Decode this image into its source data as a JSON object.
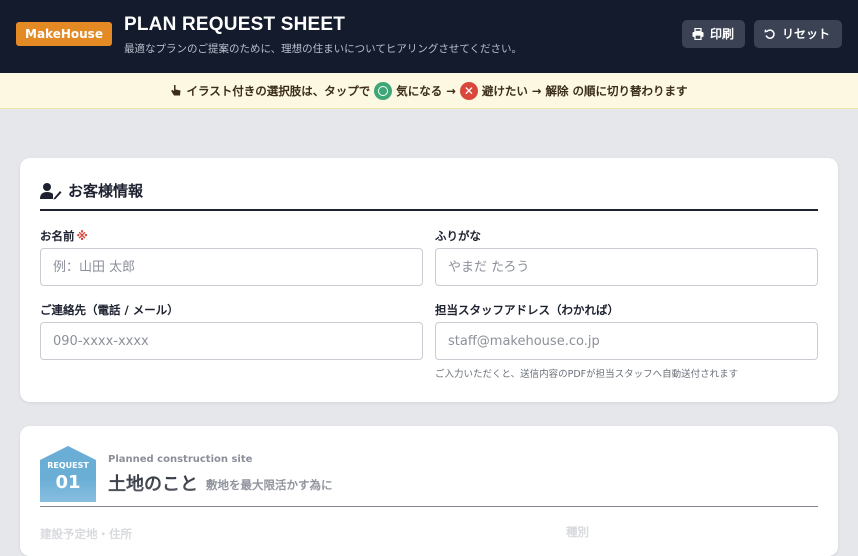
{
  "header": {
    "logo": "MakeHouse",
    "title": "PLAN REQUEST SHEET",
    "subtitle": "最適なプランのご提案のために、理想の住まいについてヒアリングさせてください。",
    "print_label": "印刷",
    "reset_label": "リセット"
  },
  "notice": {
    "text1": "イラスト付きの選択肢は、タップで",
    "ok_label": "気になる",
    "arrow1": "→",
    "ng_label": "避けたい",
    "text2": "→ 解除 の順に切り替わります",
    "ng_mark": "✕"
  },
  "customer": {
    "section_title": "お客様情報",
    "name_label": "お名前",
    "required_mark": "※",
    "name_placeholder": "例：山田 太郎",
    "furigana_label": "ふりがな",
    "furigana_placeholder": "やまだ たろう",
    "contact_label": "ご連絡先（電話 / メール）",
    "contact_placeholder": "090-xxxx-xxxx",
    "staff_label": "担当スタッフアドレス（わかれば）",
    "staff_placeholder": "staff@makehouse.co.jp",
    "staff_note": "ご入力いただくと、送信内容のPDFが担当スタッフへ自動送付されます"
  },
  "land": {
    "badge_label": "REQUEST",
    "badge_number": "01",
    "en_subtitle": "Planned construction site",
    "title": "土地のこと",
    "description": "敷地を最大限活かす為に",
    "field1_label": "建設予定地・住所",
    "field2_label": "種別"
  },
  "colors": {
    "header_bg": "#141b2d",
    "logo_bg": "#e38a25",
    "ok": "#3da776",
    "ng": "#d9473c",
    "badge": "#6aaed6"
  }
}
